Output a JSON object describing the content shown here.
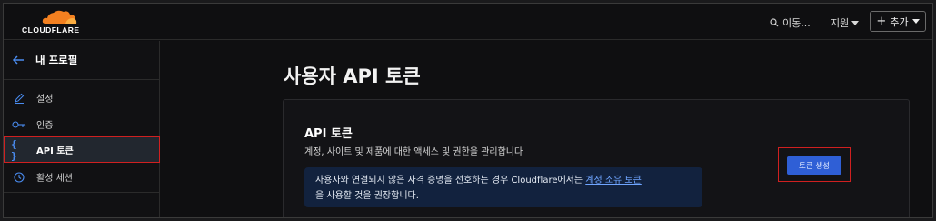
{
  "header": {
    "brand": "CLOUDFLARE",
    "search_label": "이동...",
    "support_label": "지원",
    "add_label": "추가",
    "brand_color": "#f38020"
  },
  "sidebar": {
    "title": "내 프로필",
    "items": [
      {
        "label": "설정",
        "icon": "pencil-icon"
      },
      {
        "label": "인증",
        "icon": "key-icon"
      },
      {
        "label": "API 토큰",
        "icon": "curly-braces-icon",
        "active": true
      },
      {
        "label": "활성 세션",
        "icon": "clock-icon"
      }
    ]
  },
  "main": {
    "page_title": "사용자 API 토큰",
    "card": {
      "title": "API 토큰",
      "description": "계정, 사이트 및 제품에 대한 액세스 및 권한을 관리합니다",
      "notice_prefix": "사용자와 연결되지 않은 자격 증명을 선호하는 경우 Cloudflare에서는 ",
      "notice_link": "계정 소유 토큰",
      "notice_suffix": "을 사용할 것을 권장합니다.",
      "create_button": "토큰 생성"
    }
  }
}
